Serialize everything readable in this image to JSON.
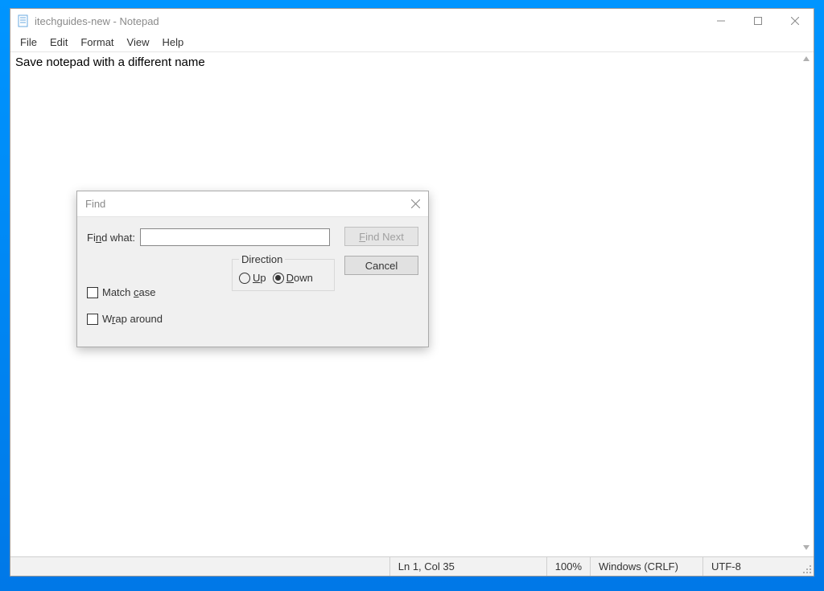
{
  "window": {
    "title": "itechguides-new - Notepad"
  },
  "menubar": {
    "file": "File",
    "edit": "Edit",
    "format": "Format",
    "view": "View",
    "help": "Help"
  },
  "editor": {
    "content": "Save notepad with a different name"
  },
  "dialog": {
    "title": "Find",
    "find_what_label": "Find what:",
    "find_what_value": "",
    "find_next_label": "Find Next",
    "cancel_label": "Cancel",
    "direction_label": "Direction",
    "up_label": "Up",
    "down_label": "Down",
    "direction_value": "down",
    "match_case_label": "Match case",
    "match_case_checked": false,
    "wrap_around_label": "Wrap around",
    "wrap_around_checked": false
  },
  "statusbar": {
    "position": "Ln 1, Col 35",
    "zoom": "100%",
    "line_ending": "Windows (CRLF)",
    "encoding": "UTF-8"
  }
}
